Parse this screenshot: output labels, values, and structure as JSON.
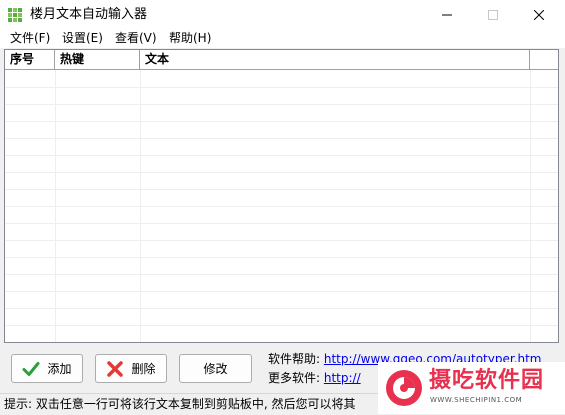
{
  "window": {
    "title": "楼月文本自动输入器"
  },
  "menu": [
    "文件(F)",
    "设置(E)",
    "查看(V)",
    "帮助(H)"
  ],
  "table": {
    "columns": [
      "序号",
      "热键",
      "文本",
      ""
    ],
    "rows": []
  },
  "buttons": {
    "add": "添加",
    "delete": "删除",
    "edit": "修改"
  },
  "links": {
    "help_label": "软件帮助:",
    "help_url": "http://www.ggeo.com/autotyper.htm",
    "more_label": "更多软件:",
    "more_url": "http://"
  },
  "status": {
    "hint": "提示: 双击任意一行可将该行文本复制到剪贴板中, 然后您可以将其"
  },
  "watermark": {
    "brand": "摄吃软件园",
    "url": "WWW.SHECHIPIN1.COM"
  },
  "colors": {
    "accent_red": "#e8304f",
    "link": "#0000ee",
    "add_icon": "#2e9e3a",
    "delete_icon": "#e53935"
  },
  "icons": {
    "app": "app-grid-icon",
    "minimize": "minimize-icon",
    "maximize": "maximize-icon",
    "close": "close-icon",
    "add": "checkmark-icon",
    "delete": "x-mark-icon",
    "watermark_logo": "brand-logo-icon"
  }
}
